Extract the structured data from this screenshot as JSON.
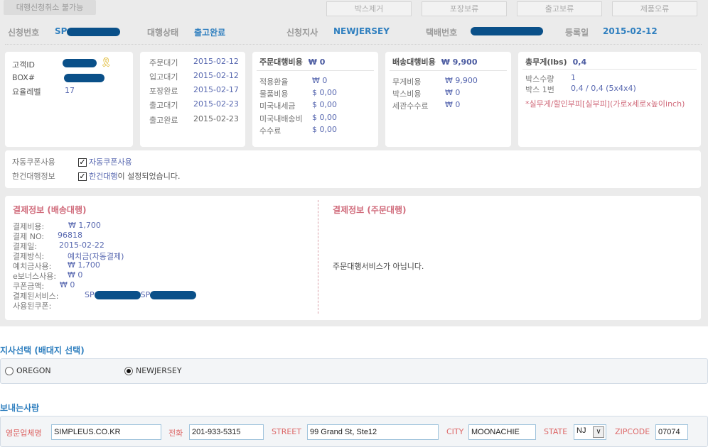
{
  "toolbar": {
    "cancel_label": "대행신청취소 불가능",
    "buttons": [
      "박스제거",
      "포장보류",
      "출고보류",
      "제품오류"
    ]
  },
  "summary": {
    "app_no_label": "신청번호",
    "app_no_prefix": "SP",
    "status_label": "대행상태",
    "status": "출고완료",
    "branch_label": "신청지사",
    "branch": "NEWJERSEY",
    "tracking_label": "택배번호",
    "reg_label": "등록일",
    "reg_date": "2015-02-12"
  },
  "customer": {
    "id_label": "고객ID",
    "box_label": "BOX#",
    "rate_label": "요율레벨",
    "rate": "17"
  },
  "timeline": [
    {
      "k": "주문대기",
      "v": "2015-02-12"
    },
    {
      "k": "입고대기",
      "v": "2015-02-12"
    },
    {
      "k": "포장완료",
      "v": "2015-02-17"
    },
    {
      "k": "출고대기",
      "v": "2015-02-23"
    },
    {
      "k": "출고완료",
      "v": "2015-02-23"
    }
  ],
  "order_cost": {
    "title": "주문대행비용",
    "total": "₩ 0",
    "rows": [
      {
        "k": "적용환율",
        "v": "₩ 0"
      },
      {
        "k": "물품비용",
        "v": "$ 0,00"
      },
      {
        "k": "미국내세금",
        "v": "$ 0,00"
      },
      {
        "k": "미국내배송비",
        "v": "$ 0,00"
      },
      {
        "k": "수수료",
        "v": "$ 0,00"
      }
    ]
  },
  "ship_cost": {
    "title": "배송대행비용",
    "total": "₩ 9,900",
    "rows": [
      {
        "k": "무게비용",
        "v": "₩ 9,900"
      },
      {
        "k": "박스비용",
        "v": "₩ 0"
      },
      {
        "k": "세관수수료",
        "v": "₩ 0"
      }
    ]
  },
  "weight": {
    "title": "총무게(lbs)",
    "total": "0,4",
    "rows": [
      {
        "k": "박스수량",
        "v": "1"
      },
      {
        "k": "박스 1번",
        "v": "0,4 / 0,4 (5x4x4)"
      }
    ],
    "note": "*실무게/할인부피[실부피](가로x세로x높이inch)"
  },
  "options": {
    "coupon_label": "자동쿠폰사용",
    "coupon_text": "자동쿠폰사용",
    "single_label": "한건대행정보",
    "single_link": "한건대행",
    "single_text": "이 설정되었습니다."
  },
  "payment": {
    "title": "결제정보 (배송대행)",
    "rows": [
      {
        "k": "결제비용:",
        "v": "₩ 1,700"
      },
      {
        "k": "결제 NO:",
        "v": "96818"
      },
      {
        "k": "결제일:",
        "v": "2015-02-22"
      },
      {
        "k": "결제방식:",
        "v": "예치금(자동결제)"
      },
      {
        "k": "예치금사용:",
        "v": "₩ 1,700"
      },
      {
        "k": "e보너스사용:",
        "v": "₩ 0"
      },
      {
        "k": "쿠폰금액:",
        "v": "₩ 0"
      },
      {
        "k": "결제된서비스:",
        "v": "SP"
      },
      {
        "k": "사용된쿠폰:",
        "v": ""
      }
    ],
    "sp2": "SP",
    "order_title": "결제정보 (주문대행)",
    "order_msg": "주문대행서비스가 아닙니다."
  },
  "branch_select": {
    "title": "지사선택 (배대지 선택)",
    "options": [
      "OREGON",
      "NEWJERSEY"
    ],
    "selected": "NEWJERSEY"
  },
  "sender": {
    "title": "보내는사람",
    "company_label": "영문업체명",
    "company": "SIMPLEUS.CO.KR",
    "phone_label": "전화",
    "phone": "201-933-5315",
    "street_label": "STREET",
    "street": "99 Grand St, Ste12",
    "city_label": "CITY",
    "city": "MOONACHIE",
    "state_label": "STATE",
    "state": "NJ",
    "zip_label": "ZIPCODE",
    "zip": "07074"
  }
}
